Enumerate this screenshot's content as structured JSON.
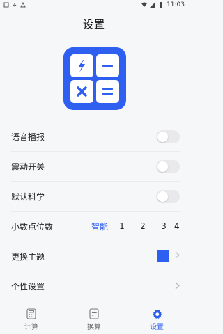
{
  "status_bar": {
    "time": "11:03"
  },
  "header": {
    "title": "设置"
  },
  "colors": {
    "accent": "#2f5ff0",
    "toggle_off": "#e9e9ec"
  },
  "settings": {
    "voice": {
      "label": "语音播报",
      "enabled": false
    },
    "vibration": {
      "label": "震动开关",
      "enabled": false
    },
    "default_scientific": {
      "label": "默认科学",
      "enabled": false
    },
    "decimals": {
      "label": "小数点位数",
      "options": [
        "智能",
        "1",
        "2",
        "3",
        "4"
      ],
      "selected": "智能"
    },
    "theme": {
      "label": "更换主题",
      "swatch_color": "#2f5ff0"
    },
    "personal": {
      "label": "个性设置"
    }
  },
  "tabs": [
    {
      "label": "计算",
      "icon": "calculator-icon",
      "active": false
    },
    {
      "label": "换算",
      "icon": "convert-icon",
      "active": false
    },
    {
      "label": "设置",
      "icon": "gear-icon",
      "active": true
    }
  ]
}
